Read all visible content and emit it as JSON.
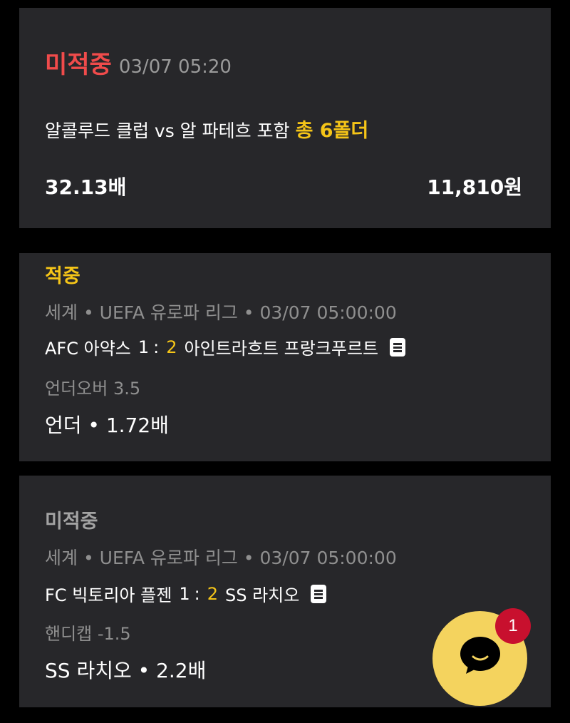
{
  "summary": {
    "status": "미적중",
    "timestamp": "03/07 05:20",
    "title": "알콜루드 클럽 vs 알 파테흐 포함",
    "folder_count": "총 6폴더",
    "total_odds": "32.13배",
    "amount": "11,810원"
  },
  "picks": [
    {
      "status": "적중",
      "meta": "세계 • UEFA 유로파 리그 • 03/07 05:00:00",
      "home": "AFC 아약스",
      "home_score": "1",
      "away_score": "2",
      "away": "아인트라흐트 프랑크푸르트",
      "market": "언더오버 3.5",
      "selection": "언더 • 1.72배"
    },
    {
      "status": "미적중",
      "meta": "세계 • UEFA 유로파 리그 • 03/07 05:00:00",
      "home": "FC 빅토리아 플젠",
      "home_score": "1",
      "away_score": "2",
      "away": "SS 라치오",
      "market": "핸디캡 -1.5",
      "selection": "SS 라치오 • 2.2배"
    }
  ],
  "chat": {
    "badge_count": "1",
    "icon": "chat-bubble-icon"
  },
  "colors": {
    "background": "#000000",
    "card": "#27272a",
    "loss": "#f04b4b",
    "win": "#f5c518",
    "chat_button": "#f4d35e",
    "badge": "#c8102e"
  }
}
